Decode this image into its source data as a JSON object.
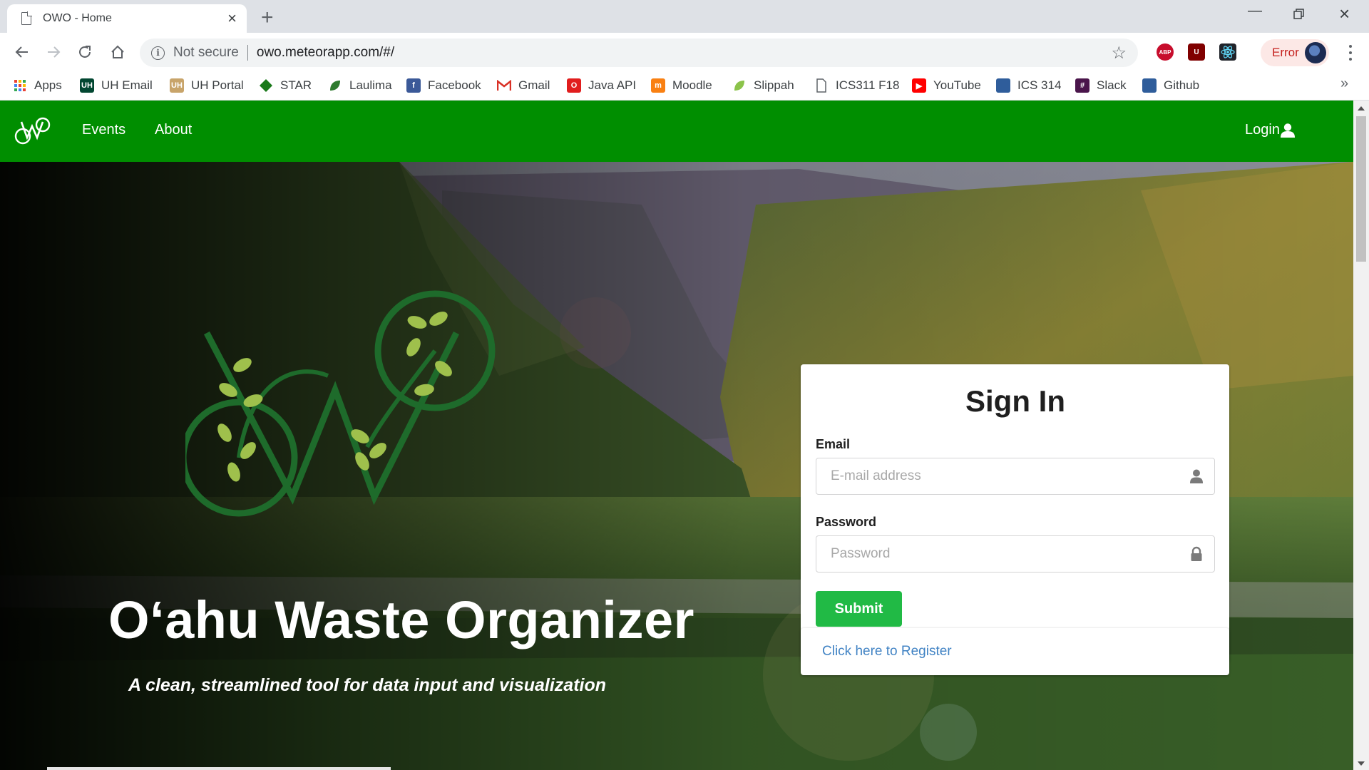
{
  "browser": {
    "tab_title": "OWO - Home",
    "omnibox_security": "Not secure",
    "omnibox_url": "owo.meteorapp.com/#/",
    "error_label": "Error",
    "extensions": [
      {
        "name": "adblock-plus-icon",
        "label": "ABP",
        "color": "#c70d2c"
      },
      {
        "name": "ublock-icon",
        "label": "U",
        "color": "#800000"
      },
      {
        "name": "react-devtools-icon",
        "label": "",
        "color": "#20232a"
      }
    ]
  },
  "bookmarks": [
    {
      "label": "Apps",
      "icon": "apps-grid-icon",
      "color": "#4285f4"
    },
    {
      "label": "UH Email",
      "icon": "uh-icon",
      "color": "#024731"
    },
    {
      "label": "UH Portal",
      "icon": "uh-icon",
      "color": "#c8a46a"
    },
    {
      "label": "STAR",
      "icon": "star-diamond-icon",
      "color": "#1b7a1b"
    },
    {
      "label": "Laulima",
      "icon": "leaf-icon",
      "color": "#2d7a2d"
    },
    {
      "label": "Facebook",
      "icon": "facebook-icon",
      "color": "#3b5998"
    },
    {
      "label": "Gmail",
      "icon": "gmail-icon",
      "color": "#d93025"
    },
    {
      "label": "Java API",
      "icon": "oracle-icon",
      "color": "#e11d1d"
    },
    {
      "label": "Moodle",
      "icon": "moodle-icon",
      "color": "#f98012"
    },
    {
      "label": "Slippah",
      "icon": "slippah-icon",
      "color": "#8bc34a"
    },
    {
      "label": "ICS311 F18",
      "icon": "document-icon",
      "color": "#5f6368"
    },
    {
      "label": "YouTube",
      "icon": "youtube-icon",
      "color": "#ff0000"
    },
    {
      "label": "ICS 314",
      "icon": "square-icon",
      "color": "#2f5d9b"
    },
    {
      "label": "Slack",
      "icon": "slack-icon",
      "color": "#4a154b"
    },
    {
      "label": "Github",
      "icon": "square-icon",
      "color": "#2f5d9b"
    }
  ],
  "site": {
    "brand_color": "#008e00",
    "nav": {
      "events": "Events",
      "about": "About",
      "login": "Login"
    },
    "hero": {
      "title": "O‘ahu Waste Organizer",
      "subtitle": "A clean, streamlined tool for data input and visualization"
    },
    "signin": {
      "heading": "Sign In",
      "email_label": "Email",
      "email_placeholder": "E-mail address",
      "password_label": "Password",
      "password_placeholder": "Password",
      "submit": "Submit",
      "submit_color": "#21ba45",
      "register_link": "Click here to Register"
    }
  }
}
